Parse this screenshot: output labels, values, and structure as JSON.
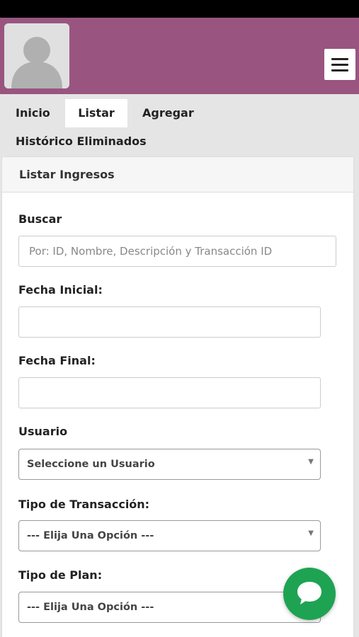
{
  "header": {
    "avatar_icon": "user-avatar-icon",
    "menu_icon": "hamburger-menu-icon",
    "brand_color": "#995580"
  },
  "tabs": [
    {
      "label": "Inicio",
      "active": false
    },
    {
      "label": "Listar",
      "active": true
    },
    {
      "label": "Agregar",
      "active": false
    },
    {
      "label": "Histórico Eliminados",
      "active": false
    }
  ],
  "panel": {
    "title": "Listar Ingresos"
  },
  "form": {
    "search": {
      "label": "Buscar",
      "placeholder": "Por: ID, Nombre, Descripción y Transacción ID",
      "value": ""
    },
    "start_date": {
      "label": "Fecha Inicial:",
      "value": ""
    },
    "end_date": {
      "label": "Fecha Final:",
      "value": ""
    },
    "user": {
      "label": "Usuario",
      "selected": "Seleccione un Usuario"
    },
    "transaction_type": {
      "label": "Tipo de Transacción:",
      "selected": "--- Elija Una Opción ---"
    },
    "plan_type": {
      "label": "Tipo de Plan:",
      "selected": "--- Elija Una Opción ---"
    }
  },
  "chat": {
    "icon": "chat-bubble-icon",
    "color": "#1ea353"
  }
}
